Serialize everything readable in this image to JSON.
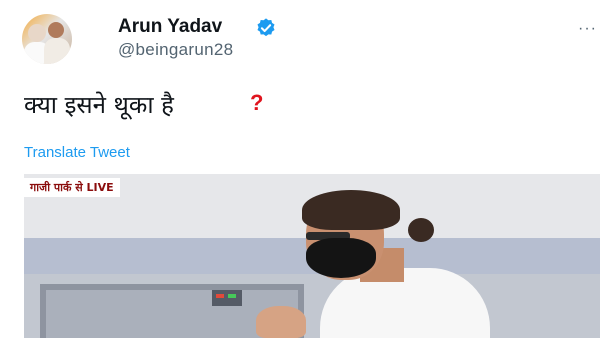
{
  "user": {
    "name": "Arun Yadav",
    "handle": "@beingarun28",
    "verified": true,
    "avatar_icon": "profile-photo"
  },
  "tweet": {
    "text": "क्या इसने थूका है",
    "emoji": "?",
    "translate_label": "Translate Tweet"
  },
  "media": {
    "overlay_label": "गाजी पार्क से LIVE"
  },
  "colors": {
    "link": "#1d9bf0",
    "verified": "#1d9bf0",
    "question_mark": "#e0141e"
  }
}
